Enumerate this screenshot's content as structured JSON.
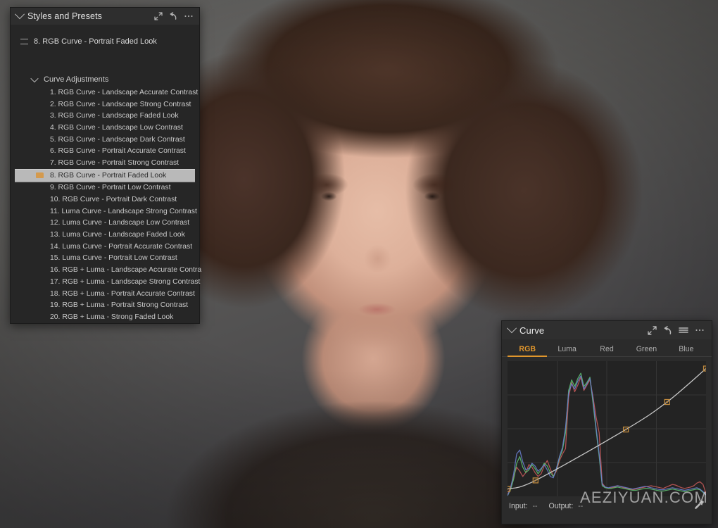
{
  "app": {
    "watermark": "AEZIYUAN.COM"
  },
  "styles_panel": {
    "title": "Styles and Presets",
    "collapse_icon": "chevron-down-icon",
    "header_icons": [
      "expand-icon",
      "reset-arrow-icon",
      "more-options-icon"
    ],
    "current_preset": "8. RGB Curve - Portrait Faded Look",
    "group": {
      "label": "Curve Adjustments",
      "expanded": true
    },
    "selected_index": 7,
    "presets": [
      "1. RGB Curve - Landscape Accurate Contrast",
      "2. RGB Curve - Landscape Strong Contrast",
      "3. RGB Curve - Landscape Faded Look",
      "4. RGB Curve - Landscape Low Contrast",
      "5. RGB Curve - Landscape Dark Contrast",
      "6. RGB Curve - Portrait Accurate Contrast",
      "7. RGB Curve - Portrait Strong Contrast",
      "8. RGB Curve - Portrait Faded Look",
      "9. RGB Curve - Portrait Low Contrast",
      "10. RGB Curve - Portrait Dark Contrast",
      "11. Luma Curve - Landscape Strong Contrast",
      "12. Luma Curve - Landscape Low Contrast",
      "13. Luma Curve - Landscape Faded Look",
      "14. Luma Curve - Portrait Accurate Contrast",
      "15. Luma Curve - Portrait Low Contrast",
      "16. RGB + Luma - Landscape Accurate Contra",
      "17. RGB + Luma - Landscape Strong Contrast",
      "18. RGB + Luma - Portrait Accurate Contrast",
      "19. RGB + Luma - Portrait Strong Contrast",
      "20. RGB + Luma - Strong Faded Look"
    ]
  },
  "curve_panel": {
    "title": "Curve",
    "collapse_icon": "chevron-down-icon",
    "header_icons": [
      "expand-icon",
      "reset-arrow-icon",
      "menu-icon",
      "more-options-icon"
    ],
    "tabs": [
      {
        "label": "RGB",
        "active": true
      },
      {
        "label": "Luma",
        "active": false
      },
      {
        "label": "Red",
        "active": false
      },
      {
        "label": "Green",
        "active": false
      },
      {
        "label": "Blue",
        "active": false
      }
    ],
    "active_tab": "RGB",
    "footer": {
      "input_label": "Input:",
      "input_value": "--",
      "output_label": "Output:",
      "output_value": "--",
      "picker_icon": "eyedropper-icon"
    },
    "colors": {
      "accent": "#e0962c",
      "curve_line": "#d8d8d8",
      "node": "#c08a3e",
      "grid": "#343434",
      "graph_bg": "#232323",
      "red_channel": "#c85a5a",
      "green_channel": "#5fc071",
      "blue_channel": "#6a7fd0"
    }
  },
  "chart_data": {
    "type": "line",
    "title": "Curve",
    "xlabel": "Input",
    "ylabel": "Output",
    "xlim": [
      0,
      255
    ],
    "ylim": [
      0,
      255
    ],
    "grid": true,
    "grid_divisions": 4,
    "legend_position": "none",
    "annotations": [
      "Input: --",
      "Output: --"
    ],
    "series": [
      {
        "name": "RGB Tone Curve",
        "kind": "spline",
        "color": "#d8d8d8",
        "control_points": [
          {
            "input": 0,
            "output": 14
          },
          {
            "input": 36,
            "output": 30
          },
          {
            "input": 152,
            "output": 126
          },
          {
            "input": 205,
            "output": 178
          },
          {
            "input": 255,
            "output": 241
          }
        ]
      },
      {
        "name": "Red histogram",
        "kind": "histogram",
        "color": "#c85a5a",
        "values": [
          2,
          14,
          30,
          44,
          38,
          30,
          36,
          48,
          44,
          36,
          30,
          34,
          46,
          54,
          42,
          30,
          38,
          54,
          64,
          72,
          150,
          172,
          158,
          168,
          180,
          160,
          168,
          176,
          150,
          120,
          96,
          20,
          14,
          12,
          13,
          14,
          16,
          15,
          13,
          12,
          11,
          10,
          11,
          12,
          13,
          14,
          15,
          16,
          15,
          14,
          13,
          12,
          14,
          16,
          18,
          17,
          15,
          13,
          12,
          13,
          14,
          16,
          20,
          22,
          18,
          4
        ]
      },
      {
        "name": "Green histogram",
        "kind": "histogram",
        "color": "#5fc071",
        "values": [
          1,
          10,
          26,
          50,
          60,
          44,
          36,
          40,
          48,
          42,
          34,
          40,
          50,
          46,
          36,
          30,
          40,
          58,
          70,
          96,
          160,
          176,
          166,
          178,
          186,
          166,
          172,
          180,
          140,
          100,
          60,
          16,
          13,
          12,
          12,
          13,
          14,
          13,
          12,
          11,
          10,
          9,
          9,
          10,
          11,
          12,
          12,
          11,
          10,
          9,
          8,
          8,
          9,
          10,
          11,
          10,
          9,
          8,
          7,
          8,
          9,
          10,
          11,
          10,
          6,
          2
        ]
      },
      {
        "name": "Blue histogram",
        "kind": "histogram",
        "color": "#6a7fd0",
        "values": [
          1,
          12,
          34,
          64,
          70,
          52,
          40,
          42,
          50,
          46,
          38,
          42,
          48,
          40,
          30,
          28,
          42,
          60,
          74,
          104,
          156,
          170,
          162,
          174,
          182,
          162,
          170,
          178,
          146,
          104,
          64,
          18,
          14,
          13,
          14,
          15,
          16,
          15,
          14,
          13,
          12,
          11,
          12,
          13,
          14,
          15,
          14,
          13,
          12,
          11,
          10,
          10,
          11,
          12,
          13,
          12,
          11,
          10,
          9,
          10,
          11,
          12,
          13,
          11,
          7,
          2
        ]
      }
    ]
  }
}
